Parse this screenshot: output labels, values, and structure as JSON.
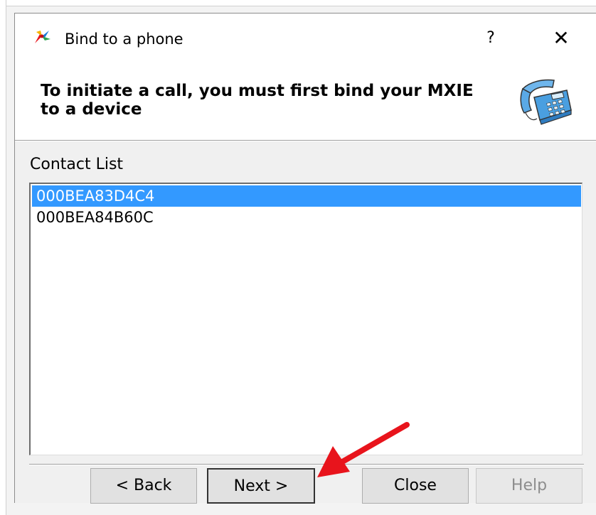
{
  "window": {
    "title": "Bind to a phone",
    "help_glyph": "?",
    "close_glyph": "✕"
  },
  "header": {
    "instruction": "To initiate a call, you must first bind your MXIE to a device"
  },
  "contact_list": {
    "label": "Contact List",
    "items": [
      {
        "label": "000BEA83D4C4",
        "selected": true
      },
      {
        "label": "000BEA84B60C",
        "selected": false
      }
    ]
  },
  "buttons": {
    "back": "< Back",
    "next": "Next >",
    "close": "Close",
    "help": "Help"
  },
  "colors": {
    "selection": "#3399ff",
    "annotation_arrow": "#e8141c"
  },
  "icons": {
    "app": "mxie-app-icon",
    "phone": "desk-phone-icon",
    "annotation": "red-arrow-annotation"
  }
}
